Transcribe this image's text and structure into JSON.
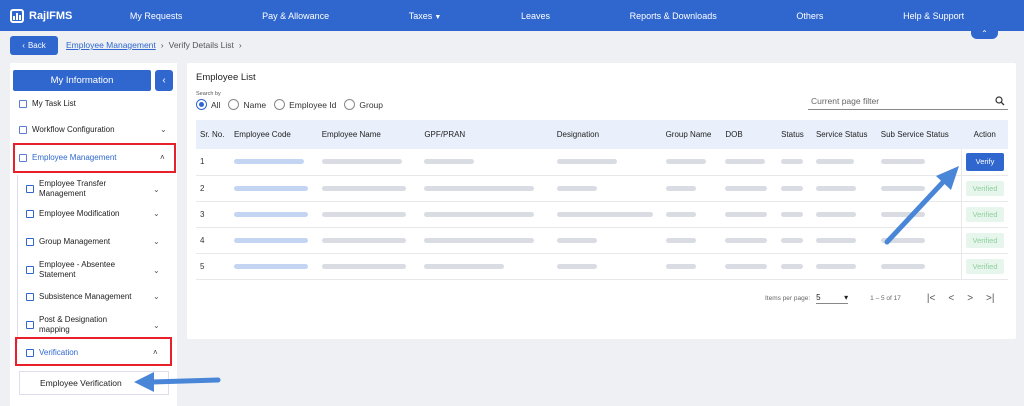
{
  "nav": {
    "brand": "RajIFMS",
    "items": [
      "My Requests",
      "Pay & Allowance",
      "Taxes",
      "Leaves",
      "Reports & Downloads",
      "Others",
      "Help & Support"
    ],
    "collapse_icon": "⌃"
  },
  "breadcrumb": {
    "back": "Back",
    "link": "Employee Management",
    "sep": "›",
    "current": "Verify Details List"
  },
  "sidebar": {
    "title": "My Information",
    "toggle": "‹",
    "items": {
      "task": "My Task List",
      "workflow": "Workflow Configuration",
      "empmgmt": "Employee Management",
      "transfer": "Employee Transfer Management",
      "modification": "Employee Modification",
      "group": "Group Management",
      "absentee": "Employee - Absentee Statement",
      "subsistence": "Subsistence Management",
      "post": "Post & Designation mapping",
      "verification": "Verification",
      "empver": "Employee Verification"
    }
  },
  "main": {
    "title": "Employee List",
    "search_by": "Search by",
    "radios": [
      "All",
      "Name",
      "Employee Id",
      "Group"
    ],
    "filter_placeholder": "Current page filter",
    "columns": [
      "Sr. No.",
      "Employee Code",
      "Employee Name",
      "GPF/PRAN",
      "Designation",
      "Group Name",
      "DOB",
      "Status",
      "Service Status",
      "Sub Service Status",
      "Action"
    ],
    "rows": [
      {
        "sr": "1",
        "action": "Verify"
      },
      {
        "sr": "2",
        "action": "Verified"
      },
      {
        "sr": "3",
        "action": "Verified"
      },
      {
        "sr": "4",
        "action": "Verified"
      },
      {
        "sr": "5",
        "action": "Verified"
      }
    ],
    "pager": {
      "label": "Items per page:",
      "size": "5",
      "range": "1 – 5 of 17",
      "first": "|<",
      "prev": "<",
      "next": ">",
      "last": ">|"
    }
  },
  "colors": {
    "primary": "#2f67cf",
    "highlight": "#e8202a",
    "arrow": "#4a86d8",
    "verified_bg": "#e7f6ec"
  }
}
